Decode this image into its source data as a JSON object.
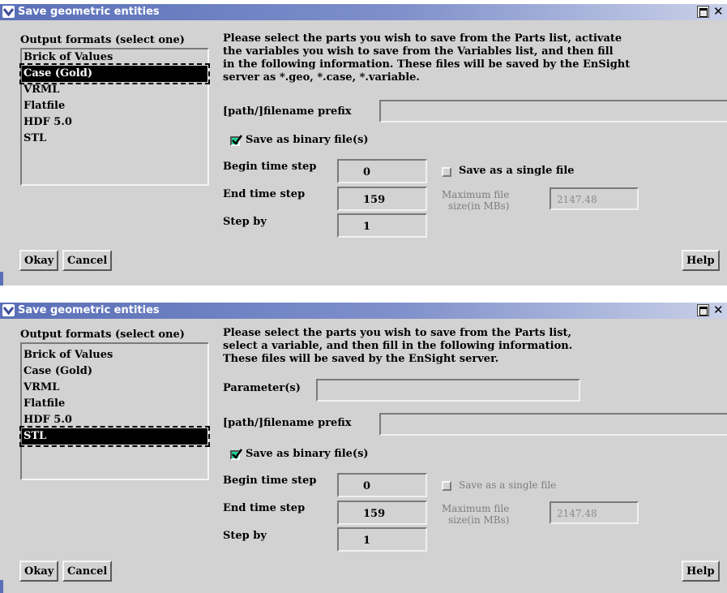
{
  "dialog_title": "Save geometric entities",
  "output_formats_label": "Output formats (select one)",
  "formats": [
    "Brick of Values",
    "Case (Gold)",
    "VRML",
    "Flatfile",
    "HDF 5.0",
    "STL"
  ],
  "dialog1": {
    "selected_format": "Case (Gold)",
    "instructions": [
      "Please select the parts you wish to save from the Parts list, activate",
      "the variables you wish to save from the Variables list, and then fill",
      "in the following information. These files will be saved by the EnSight",
      "server as *.geo, *.case, *.variable."
    ]
  },
  "dialog2": {
    "selected_format": "STL",
    "instructions": [
      "Please select the parts you wish to save from the Parts list,",
      "select a variable, and then fill in the following information.",
      "These files will be saved by the EnSight server."
    ],
    "parameters_label": "Parameter(s)",
    "parameters_value": ""
  },
  "filename_prefix_label": "[path/]filename prefix",
  "filename_prefix_value": "",
  "save_binary_label": "Save as binary file(s)",
  "save_binary_checked": true,
  "begin_time_step_label": "Begin time step",
  "begin_time_step": "0",
  "end_time_step_label": "End time step",
  "end_time_step": "159",
  "step_by_label": "Step by",
  "step_by": "1",
  "single_file_label": "Save as a single file",
  "single_file_checked": false,
  "max_file_size_label_line1": "Maximum file",
  "max_file_size_label_line2": "size(in MBs)",
  "max_file_size": "2147.48",
  "buttons": {
    "okay": "Okay",
    "cancel": "Cancel",
    "help": "Help"
  },
  "colors": {
    "title_bar": "#5a6fb8",
    "dialog_bg": "#d2d2d2",
    "checkbox_on": "#1fd39a"
  }
}
